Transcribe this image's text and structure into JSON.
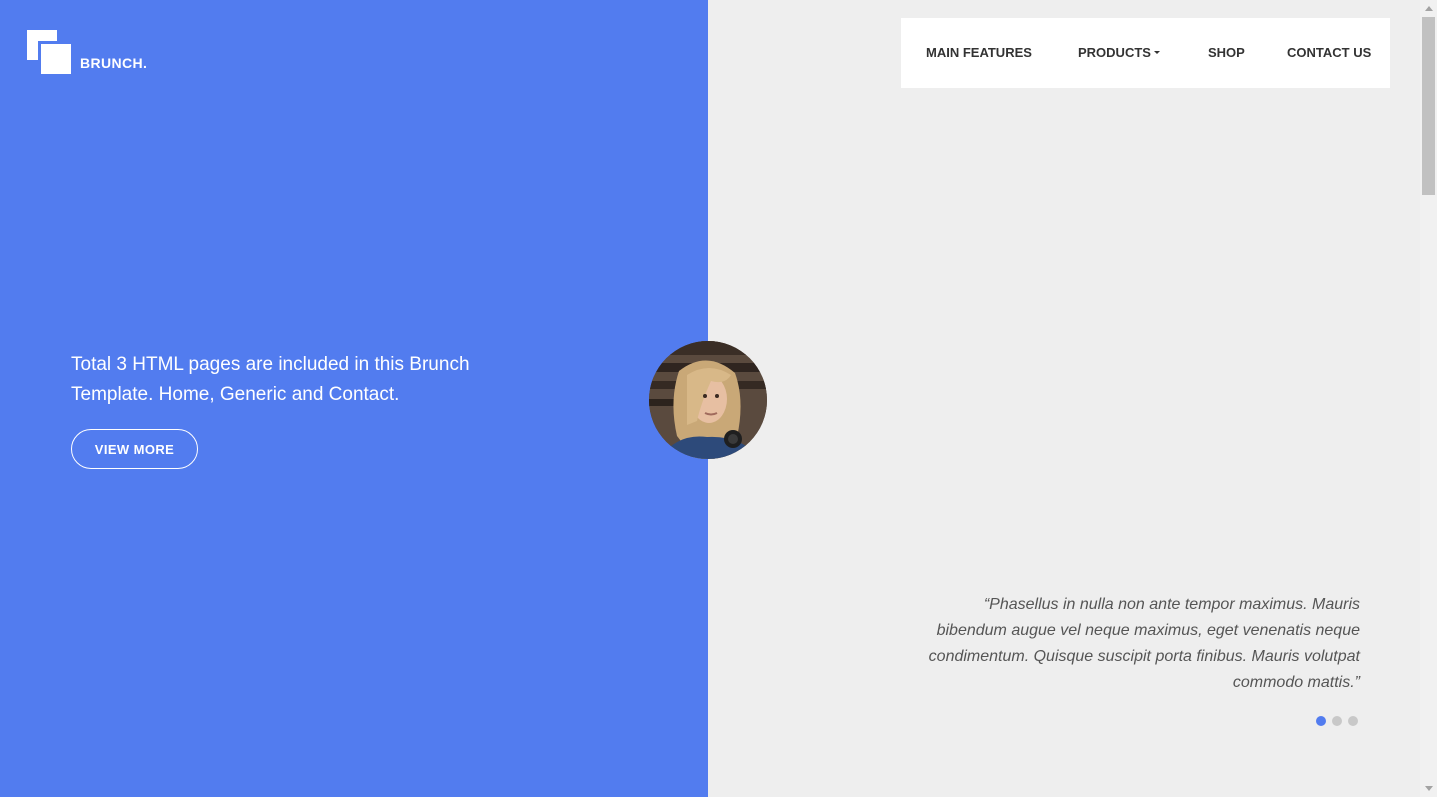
{
  "brand": {
    "name": "BRUNCH."
  },
  "nav": {
    "items": [
      {
        "label": "MAIN FEATURES"
      },
      {
        "label": "PRODUCTS"
      },
      {
        "label": "SHOP"
      },
      {
        "label": "CONTACT US"
      }
    ]
  },
  "hero": {
    "text": "Total 3 HTML pages are included in this Brunch Template. Home, Generic and Contact.",
    "button_label": "VIEW MORE"
  },
  "testimonial": {
    "quote": "“Phasellus in nulla non ante tempor maximus. Mauris bibendum augue vel neque maximus, eget venenatis neque condimentum. Quisque suscipit porta finibus. Mauris volutpat commodo mattis.”",
    "slides": 3,
    "active_slide": 1
  },
  "colors": {
    "accent": "#527cef",
    "background": "#eeeeee",
    "dot_inactive": "#c8c8c8"
  },
  "icons": [
    "brunch-logo-icon",
    "caret-down-icon"
  ]
}
